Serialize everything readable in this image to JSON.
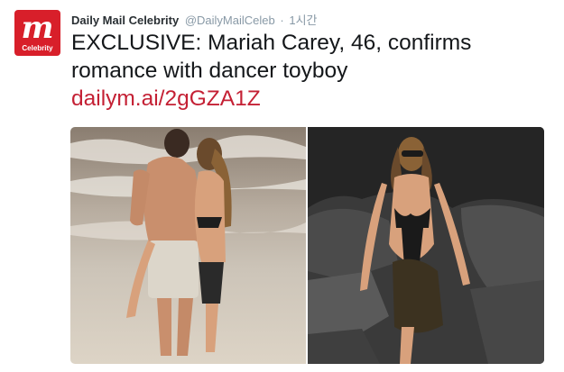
{
  "tweet": {
    "author": {
      "display_name": "Daily Mail Celebrity",
      "handle": "@DailyMailCeleb",
      "separator": "·",
      "time": "1시간",
      "avatar_logo": "m",
      "avatar_caption": "Celebrity"
    },
    "text": "EXCLUSIVE: Mariah Carey, 46, confirms romance with dancer toyboy",
    "link": "dailym.ai/2gGZA1Z",
    "media": [
      {
        "name": "couple-beach-photo"
      },
      {
        "name": "rocks-swimsuit-photo"
      }
    ]
  },
  "colors": {
    "brand": "#d81f2a",
    "link": "#c42034",
    "meta": "#8899a6"
  }
}
